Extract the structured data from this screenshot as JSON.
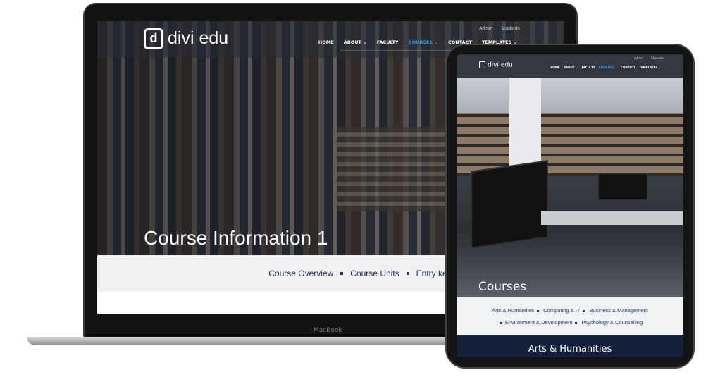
{
  "laptop": {
    "brand": "MacBook",
    "site": {
      "logo": "divi edu",
      "top_links": [
        "Admin",
        "Students"
      ],
      "nav": [
        "HOME",
        "ABOUT ⌄",
        "FACULTY",
        "COURSES ⌄",
        "CONTACT",
        "TEMPLATES ⌄"
      ],
      "active_nav": "COURSES",
      "accent": "#2ea3f2",
      "hero_title": "Course Information 1",
      "sub_links": [
        "Course Overview",
        "Course Units",
        "Entry key and information"
      ]
    }
  },
  "tablet": {
    "site": {
      "logo": "divi edu",
      "top_links": [
        "Admin",
        "Students"
      ],
      "nav": [
        "HOME",
        "ABOUT ⌄",
        "FACULTY",
        "COURSES ⌄",
        "CONTACT",
        "TEMPLATES ⌄"
      ],
      "hero_title": "Courses",
      "categories": [
        "Arts & Humanities",
        "Computing & IT",
        "Business & Management",
        "Environment & Development",
        "Psychology & Counselling"
      ],
      "section_title": "Arts & Humanities"
    }
  }
}
